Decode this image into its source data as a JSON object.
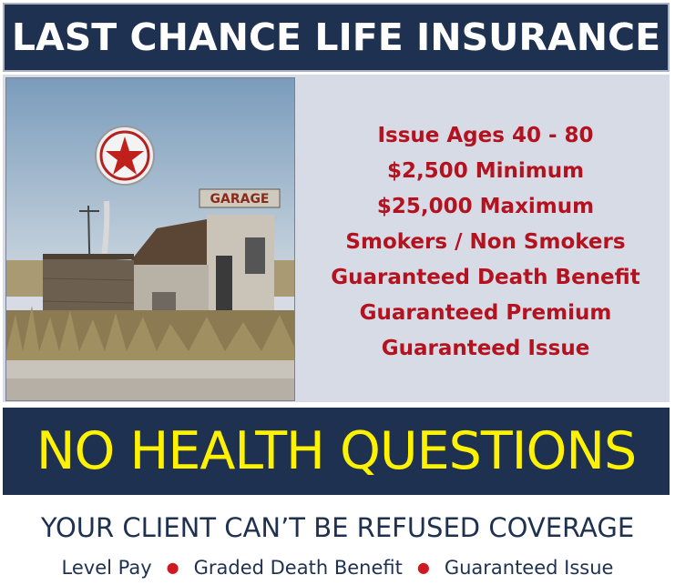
{
  "header": {
    "title": "LAST CHANCE LIFE INSURANCE"
  },
  "photo": {
    "sign_text": "GARAGE"
  },
  "features": [
    "Issue Ages  40 - 80",
    "$2,500 Minimum",
    "$25,000 Maximum",
    "Smokers / Non Smokers",
    "Guaranteed Death Benefit",
    "Guaranteed Premium",
    "Guaranteed Issue"
  ],
  "banner": {
    "text": "NO HEALTH QUESTIONS"
  },
  "tagline": {
    "text": "YOUR CLIENT CAN’T BE REFUSED COVERAGE"
  },
  "bullets": [
    "Level Pay",
    "Graded Death Benefit",
    "Guaranteed Issue"
  ],
  "colors": {
    "navy": "#1f3150",
    "panel": "#d6dbe6",
    "feature_red": "#b3121e",
    "banner_yellow": "#fff200",
    "bullet_red": "#d01820"
  }
}
